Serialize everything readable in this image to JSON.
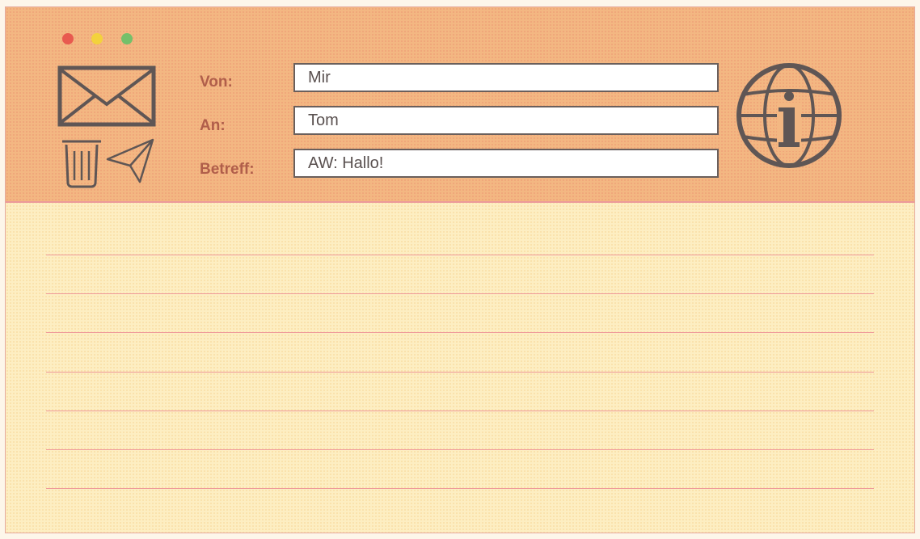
{
  "window": {
    "controls": {
      "close_color": "#e85a4f",
      "minimize_color": "#f3d23c",
      "maximize_color": "#74c06a"
    }
  },
  "header": {
    "icons": {
      "mail": "envelope-icon",
      "delete": "trash-icon",
      "send": "paper-plane-icon",
      "info": "globe-info-icon"
    },
    "fields": {
      "from": {
        "label": "Von:",
        "value": "Mir"
      },
      "to": {
        "label": "An:",
        "value": "Tom"
      },
      "subject": {
        "label": "Betreff:",
        "value": "AW: Hallo!"
      }
    }
  },
  "body": {
    "text": ""
  },
  "colors": {
    "header_bg": "#f3b782",
    "body_bg": "#fdeec2",
    "line": "#ef9a9a",
    "label": "#b05e4a",
    "icon": "#5f5655"
  }
}
